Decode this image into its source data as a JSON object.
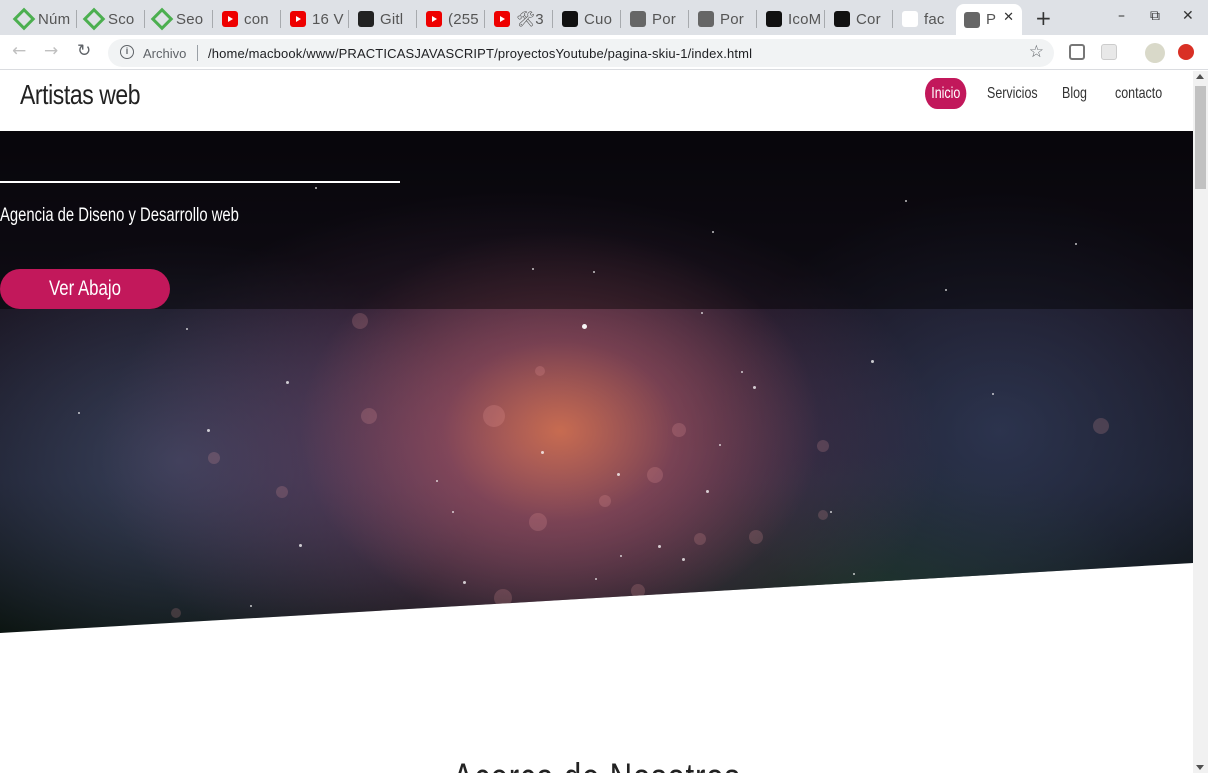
{
  "browser": {
    "tabs": [
      {
        "title": "Núm",
        "favicon": "green-diamond-icon"
      },
      {
        "title": "Sco",
        "favicon": "green-diamond-icon"
      },
      {
        "title": "Seo",
        "favicon": "green-diamond-icon"
      },
      {
        "title": "con",
        "favicon": "youtube-icon"
      },
      {
        "title": "16 V",
        "favicon": "youtube-icon"
      },
      {
        "title": "Gitl",
        "favicon": "github-icon"
      },
      {
        "title": "(255",
        "favicon": "youtube-icon"
      },
      {
        "title": "🛠3",
        "favicon": "youtube-icon"
      },
      {
        "title": "Cuo",
        "favicon": "codepen-icon"
      },
      {
        "title": "Por",
        "favicon": "globe-icon"
      },
      {
        "title": "Por",
        "favicon": "globe-icon"
      },
      {
        "title": "IcoM",
        "favicon": "icomoon-icon"
      },
      {
        "title": "Cor",
        "favicon": "codepen-icon"
      },
      {
        "title": "fac",
        "favicon": "google-icon"
      },
      {
        "title": "P",
        "favicon": "globe-icon"
      }
    ],
    "active_tab_close": "✕",
    "new_tab": "+",
    "window_controls": {
      "minimize": "–",
      "restore": "⧉",
      "close": "✕"
    },
    "nav": {
      "back": "←",
      "forward": "→",
      "reload": "↻"
    },
    "address": {
      "security_label": "Archivo",
      "url": "/home/macbook/www/PRACTICASJAVASCRIPT/proyectosYoutube/pagina-skiu-1/index.html",
      "bookmark": "☆"
    }
  },
  "site": {
    "brand": "Artistas web",
    "nav": [
      {
        "label": "Inicio",
        "active": true
      },
      {
        "label": "Servicios",
        "active": false
      },
      {
        "label": "Blog",
        "active": false
      },
      {
        "label": "contacto",
        "active": false
      }
    ],
    "hero": {
      "tagline": "Agencia de Diseno y Desarrollo web",
      "cta_label": "Ver Abajo"
    },
    "section_title": "Acerca de Nosotros"
  },
  "colors": {
    "accent": "#c2185b",
    "tabstrip": "#dee1e6"
  }
}
